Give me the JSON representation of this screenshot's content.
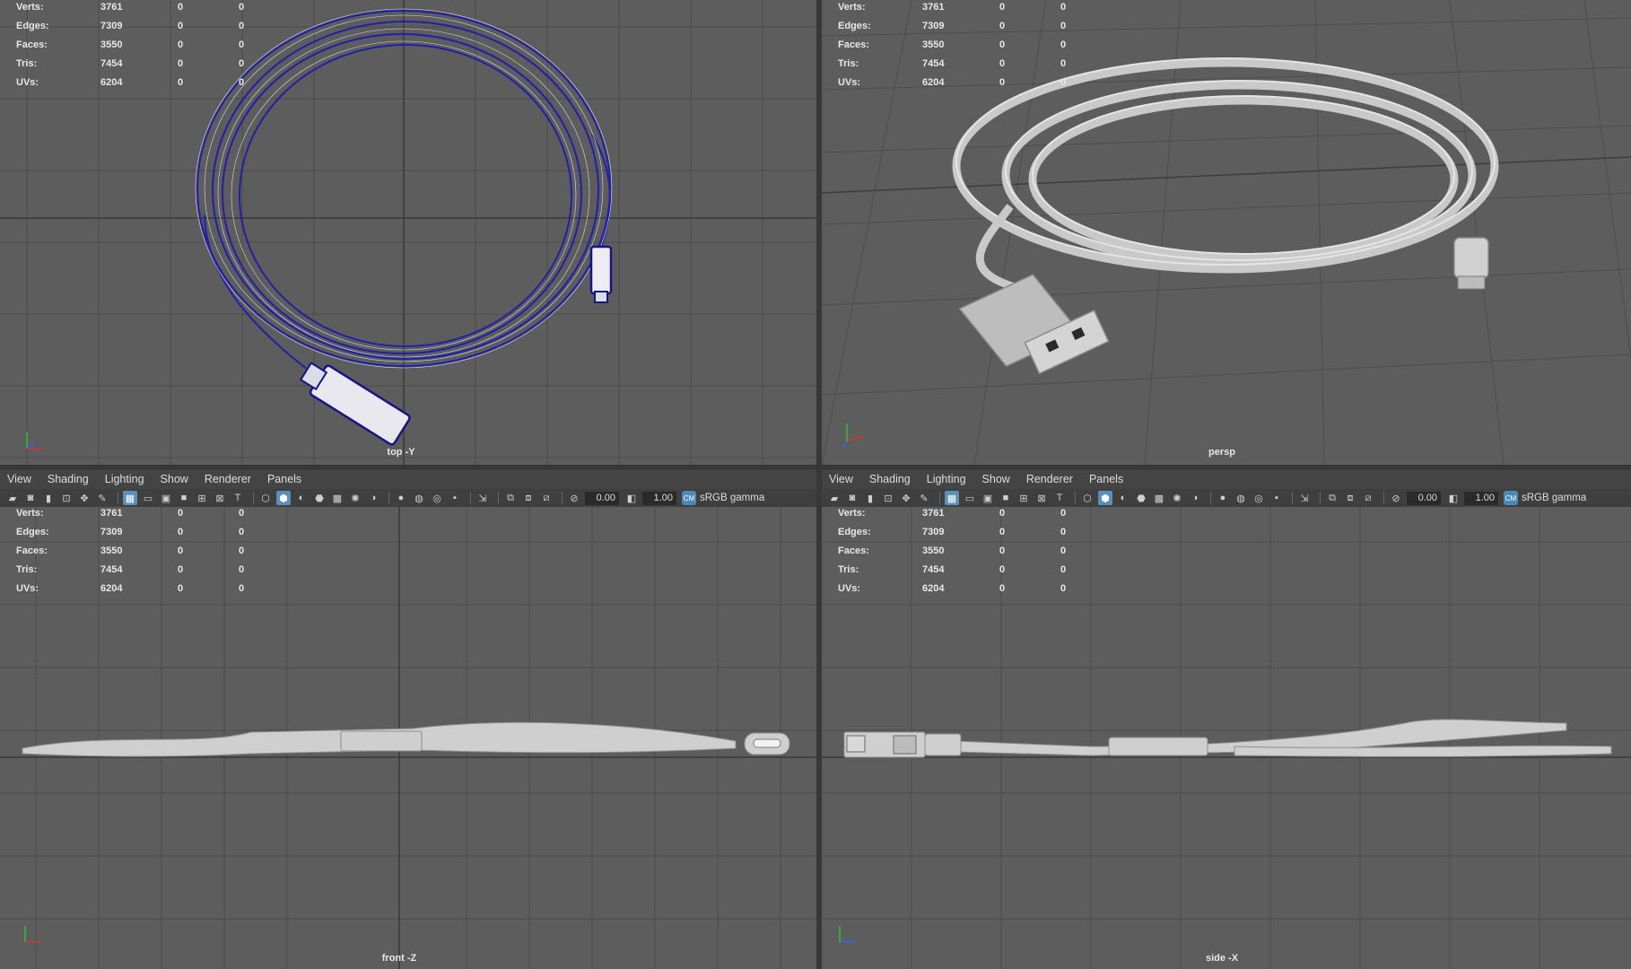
{
  "stats": {
    "rows": [
      {
        "label": "Verts:",
        "total": "3761",
        "sel": "0",
        "tri": "0"
      },
      {
        "label": "Edges:",
        "total": "7309",
        "sel": "0",
        "tri": "0"
      },
      {
        "label": "Faces:",
        "total": "3550",
        "sel": "0",
        "tri": "0"
      },
      {
        "label": "Tris:",
        "total": "7454",
        "sel": "0",
        "tri": "0"
      },
      {
        "label": "UVs:",
        "total": "6204",
        "sel": "0",
        "tri": "0"
      }
    ]
  },
  "viewports": {
    "top": {
      "camera": "top -Y"
    },
    "persp": {
      "camera": "persp"
    },
    "front": {
      "camera": "front -Z"
    },
    "side": {
      "camera": "side -X"
    }
  },
  "panel_menu": [
    "View",
    "Shading",
    "Lighting",
    "Show",
    "Renderer",
    "Panels"
  ],
  "toolbar": {
    "exposure": "0.00",
    "gamma": "1.00",
    "color_space": "sRGB gamma",
    "color_space_icon": "color-management-icon"
  },
  "colors": {
    "viewport_bg": "#5d5d5d",
    "grid": "#4a4a4a",
    "wireframe": "#1a1aa0",
    "cable": "#cfcfcf"
  }
}
